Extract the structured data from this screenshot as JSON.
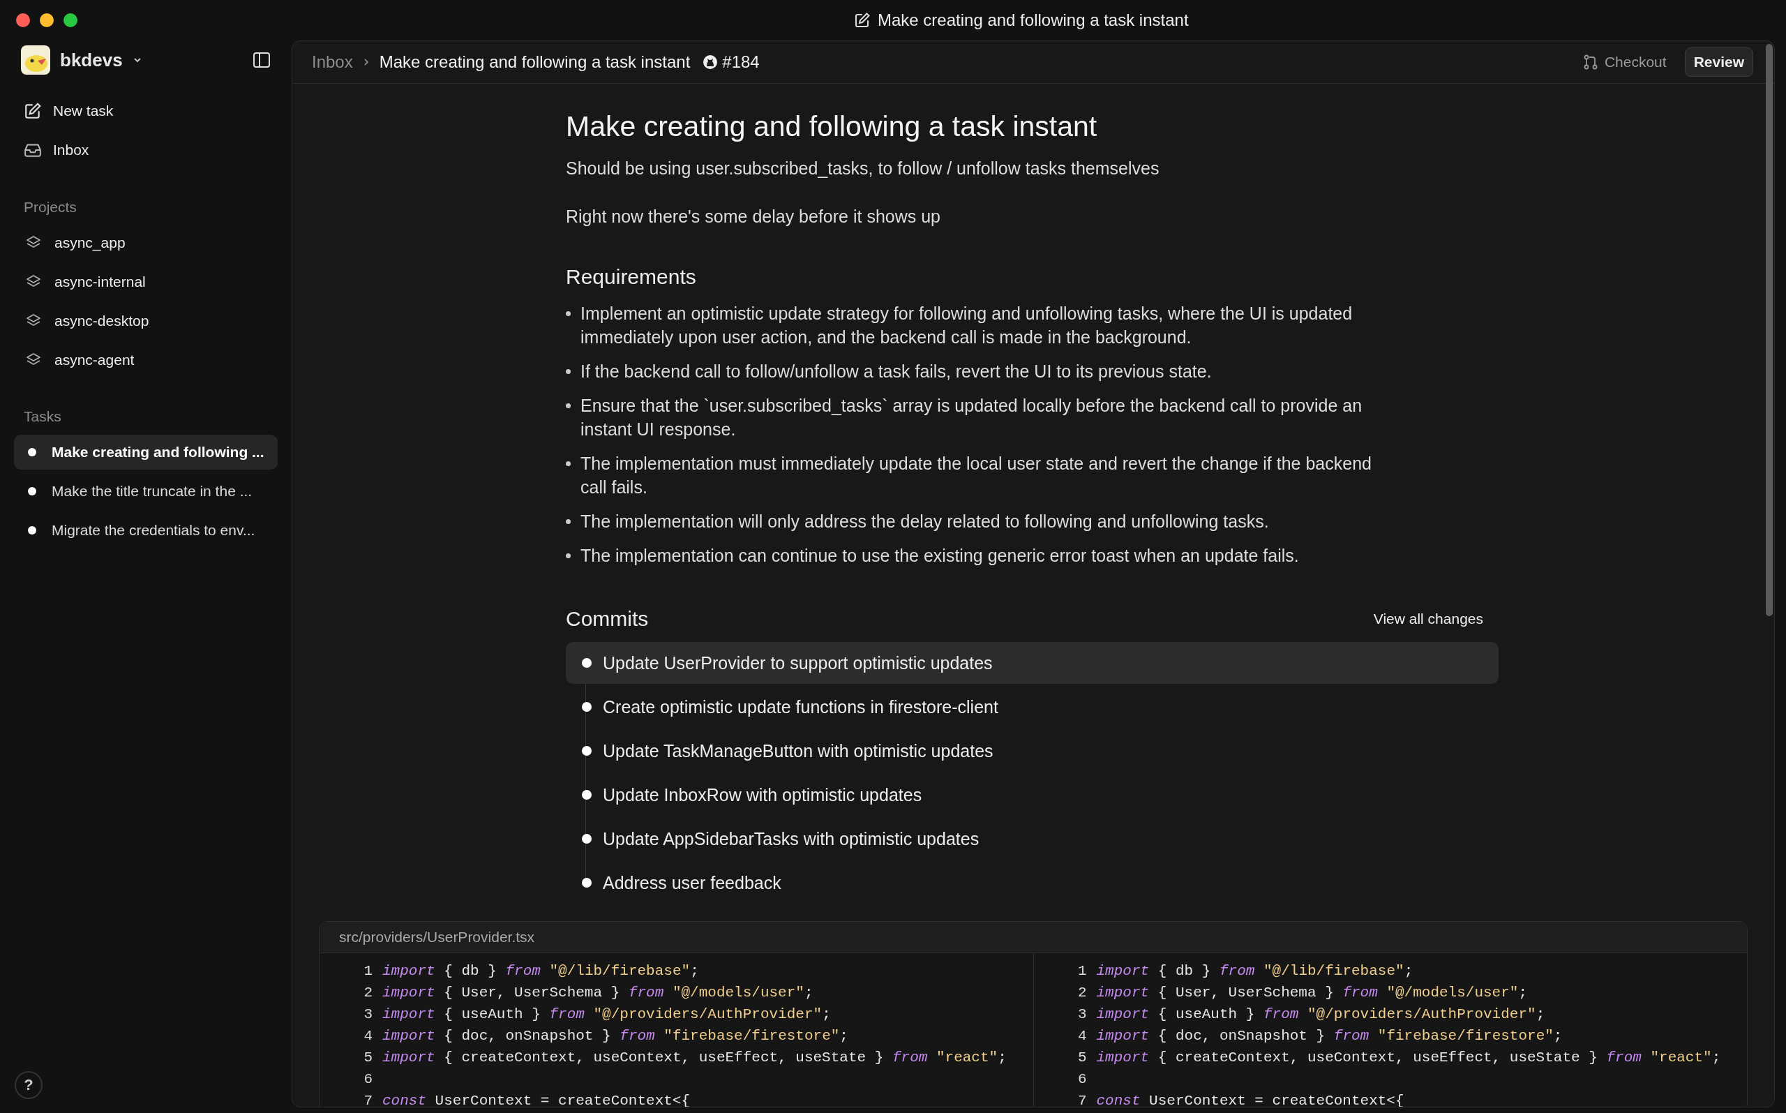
{
  "window": {
    "title": "Make creating and following a task instant"
  },
  "sidebar": {
    "workspace": "bkdevs",
    "nav": [
      {
        "kind": "new",
        "label": "New task"
      },
      {
        "kind": "inbox",
        "label": "Inbox"
      }
    ],
    "projects_heading": "Projects",
    "projects": [
      {
        "label": "async_app"
      },
      {
        "label": "async-internal"
      },
      {
        "label": "async-desktop"
      },
      {
        "label": "async-agent"
      }
    ],
    "tasks_heading": "Tasks",
    "tasks": [
      {
        "label": "Make creating and following ...",
        "selected": true
      },
      {
        "label": "Make the title truncate in the ...",
        "selected": false
      },
      {
        "label": "Migrate the credentials to env...",
        "selected": false
      }
    ]
  },
  "header": {
    "breadcrumb": "Inbox",
    "title": "Make creating and following a task instant",
    "issue": "#184",
    "checkout": "Checkout",
    "review": "Review"
  },
  "task": {
    "title": "Make creating and following a task instant",
    "description": [
      "Should be using user.subscribed_tasks, to follow / unfollow tasks themselves",
      "Right now there's some delay before it shows up"
    ],
    "requirements_heading": "Requirements",
    "requirements": [
      "Implement an optimistic update strategy for following and unfollowing tasks, where the UI is updated immediately upon user action, and the backend call is made in the background.",
      "If the backend call to follow/unfollow a task fails, revert the UI to its previous state.",
      "Ensure that the `user.subscribed_tasks` array is updated locally before the backend call to provide an instant UI response.",
      "The implementation must immediately update the local user state and revert the change if the backend call fails.",
      "The implementation will only address the delay related to following and unfollowing tasks.",
      "The implementation can continue to use the existing generic error toast when an update fails."
    ],
    "commits_heading": "Commits",
    "view_all": "View all changes",
    "commits": [
      {
        "label": "Update UserProvider to support optimistic updates",
        "selected": true
      },
      {
        "label": "Create optimistic update functions in firestore-client",
        "selected": false
      },
      {
        "label": "Update TaskManageButton with optimistic updates",
        "selected": false
      },
      {
        "label": "Update InboxRow with optimistic updates",
        "selected": false
      },
      {
        "label": "Update AppSidebarTasks with optimistic updates",
        "selected": false
      },
      {
        "label": "Address user feedback",
        "selected": false
      }
    ]
  },
  "diff": {
    "file": "src/providers/UserProvider.tsx",
    "panes": [
      {
        "lines": [
          {
            "number": "1",
            "tokens": [
              {
                "kind": "keyword",
                "text": "import"
              },
              {
                "kind": "plain",
                "text": " { db } "
              },
              {
                "kind": "keyword",
                "text": "from"
              },
              {
                "kind": "string",
                "text": " \"@/lib/firebase\""
              },
              {
                "kind": "plain",
                "text": ";"
              }
            ]
          },
          {
            "number": "2",
            "tokens": [
              {
                "kind": "keyword",
                "text": "import"
              },
              {
                "kind": "plain",
                "text": " { User, UserSchema } "
              },
              {
                "kind": "keyword",
                "text": "from"
              },
              {
                "kind": "string",
                "text": " \"@/models/user\""
              },
              {
                "kind": "plain",
                "text": ";"
              }
            ]
          },
          {
            "number": "3",
            "tokens": [
              {
                "kind": "keyword",
                "text": "import"
              },
              {
                "kind": "plain",
                "text": " { useAuth } "
              },
              {
                "kind": "keyword",
                "text": "from"
              },
              {
                "kind": "string",
                "text": " \"@/providers/AuthProvider\""
              },
              {
                "kind": "plain",
                "text": ";"
              }
            ]
          },
          {
            "number": "4",
            "tokens": [
              {
                "kind": "keyword",
                "text": "import"
              },
              {
                "kind": "plain",
                "text": " { doc, onSnapshot } "
              },
              {
                "kind": "keyword",
                "text": "from"
              },
              {
                "kind": "string",
                "text": " \"firebase/firestore\""
              },
              {
                "kind": "plain",
                "text": ";"
              }
            ]
          },
          {
            "number": "5",
            "tokens": [
              {
                "kind": "keyword",
                "text": "import"
              },
              {
                "kind": "plain",
                "text": " { createContext, useContext, useEffect, useState } "
              },
              {
                "kind": "keyword",
                "text": "from"
              },
              {
                "kind": "string",
                "text": " \"react\""
              },
              {
                "kind": "plain",
                "text": ";"
              }
            ]
          },
          {
            "number": "6"
          },
          {
            "number": "7",
            "tokens": [
              {
                "kind": "keyword",
                "text": "const"
              },
              {
                "kind": "plain",
                "text": " UserContext = createContext<{"
              }
            ]
          }
        ]
      },
      {
        "lines": [
          {
            "number": "1",
            "tokens": [
              {
                "kind": "keyword",
                "text": "import"
              },
              {
                "kind": "plain",
                "text": " { db } "
              },
              {
                "kind": "keyword",
                "text": "from"
              },
              {
                "kind": "string",
                "text": " \"@/lib/firebase\""
              },
              {
                "kind": "plain",
                "text": ";"
              }
            ]
          },
          {
            "number": "2",
            "tokens": [
              {
                "kind": "keyword",
                "text": "import"
              },
              {
                "kind": "plain",
                "text": " { User, UserSchema } "
              },
              {
                "kind": "keyword",
                "text": "from"
              },
              {
                "kind": "string",
                "text": " \"@/models/user\""
              },
              {
                "kind": "plain",
                "text": ";"
              }
            ]
          },
          {
            "number": "3",
            "tokens": [
              {
                "kind": "keyword",
                "text": "import"
              },
              {
                "kind": "plain",
                "text": " { useAuth } "
              },
              {
                "kind": "keyword",
                "text": "from"
              },
              {
                "kind": "string",
                "text": " \"@/providers/AuthProvider\""
              },
              {
                "kind": "plain",
                "text": ";"
              }
            ]
          },
          {
            "number": "4",
            "tokens": [
              {
                "kind": "keyword",
                "text": "import"
              },
              {
                "kind": "plain",
                "text": " { doc, onSnapshot } "
              },
              {
                "kind": "keyword",
                "text": "from"
              },
              {
                "kind": "string",
                "text": " \"firebase/firestore\""
              },
              {
                "kind": "plain",
                "text": ";"
              }
            ]
          },
          {
            "number": "5",
            "tokens": [
              {
                "kind": "keyword",
                "text": "import"
              },
              {
                "kind": "plain",
                "text": " { createContext, useContext, useEffect, useState } "
              },
              {
                "kind": "keyword",
                "text": "from"
              },
              {
                "kind": "string",
                "text": " \"react\""
              },
              {
                "kind": "plain",
                "text": ";"
              }
            ]
          },
          {
            "number": "6"
          },
          {
            "number": "7",
            "tokens": [
              {
                "kind": "keyword",
                "text": "const"
              },
              {
                "kind": "plain",
                "text": " UserContext = createContext<{"
              }
            ]
          }
        ]
      }
    ]
  },
  "help": "?"
}
